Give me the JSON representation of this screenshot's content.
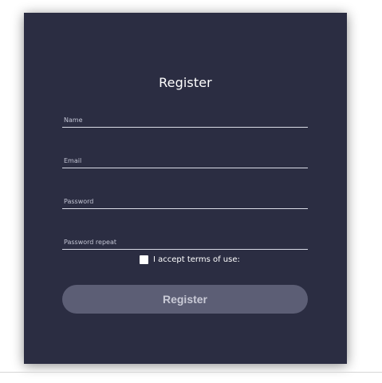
{
  "form": {
    "title": "Register",
    "fields": [
      {
        "placeholder": "Name",
        "value": ""
      },
      {
        "placeholder": "Email",
        "value": ""
      },
      {
        "placeholder": "Password",
        "value": ""
      },
      {
        "placeholder": "Password repeat",
        "value": ""
      }
    ],
    "terms_label": "I accept terms of use:",
    "terms_checked": false,
    "submit_label": "Register"
  },
  "colors": {
    "card_background": "#2b2d42",
    "button_background": "#5c5e75",
    "text": "#ffffff"
  }
}
